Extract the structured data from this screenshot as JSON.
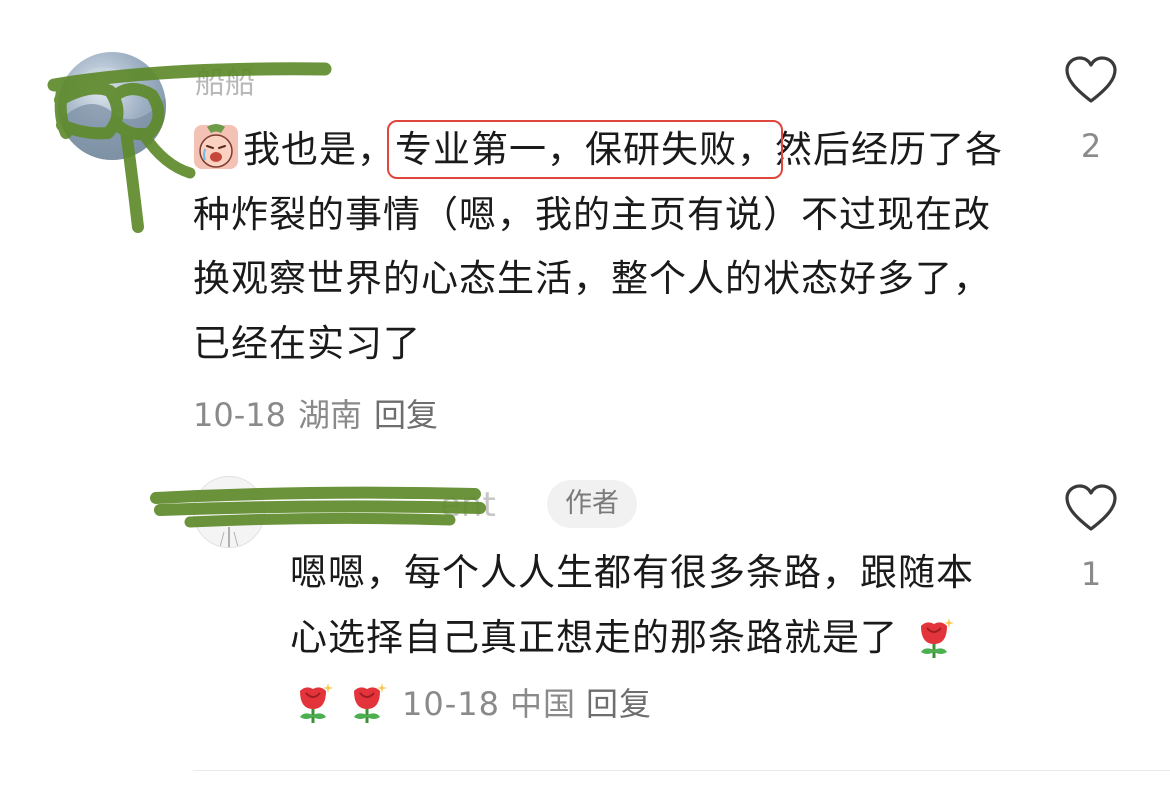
{
  "comment": {
    "username": "船船",
    "sticker": "crying-face-sticker",
    "text_pre": "我也是，",
    "text_highlight": "专业第一，保研失败，",
    "text_post": "然后经历了各种炸裂的事情（嗯，我的主页有说）不过现在改换观察世界的心态生活，整个人的状态好多了，已经在实习了",
    "date": "10-18",
    "location": "湖南",
    "reply_label": "回复",
    "like_count": "2"
  },
  "reply": {
    "username": "ent",
    "author_badge": "作者",
    "text": "嗯嗯，每个人人生都有很多条路，跟随本心选择自己真正想走的那条路就是了",
    "emoji": [
      "rose-emoji",
      "rose-emoji",
      "rose-emoji"
    ],
    "date": "10-18",
    "location": "中国",
    "reply_label": "回复",
    "like_count": "1"
  },
  "colors": {
    "highlight_box": "#e0463c",
    "meta_text": "#8a8a8a",
    "scribble": "#5f8a2c"
  }
}
